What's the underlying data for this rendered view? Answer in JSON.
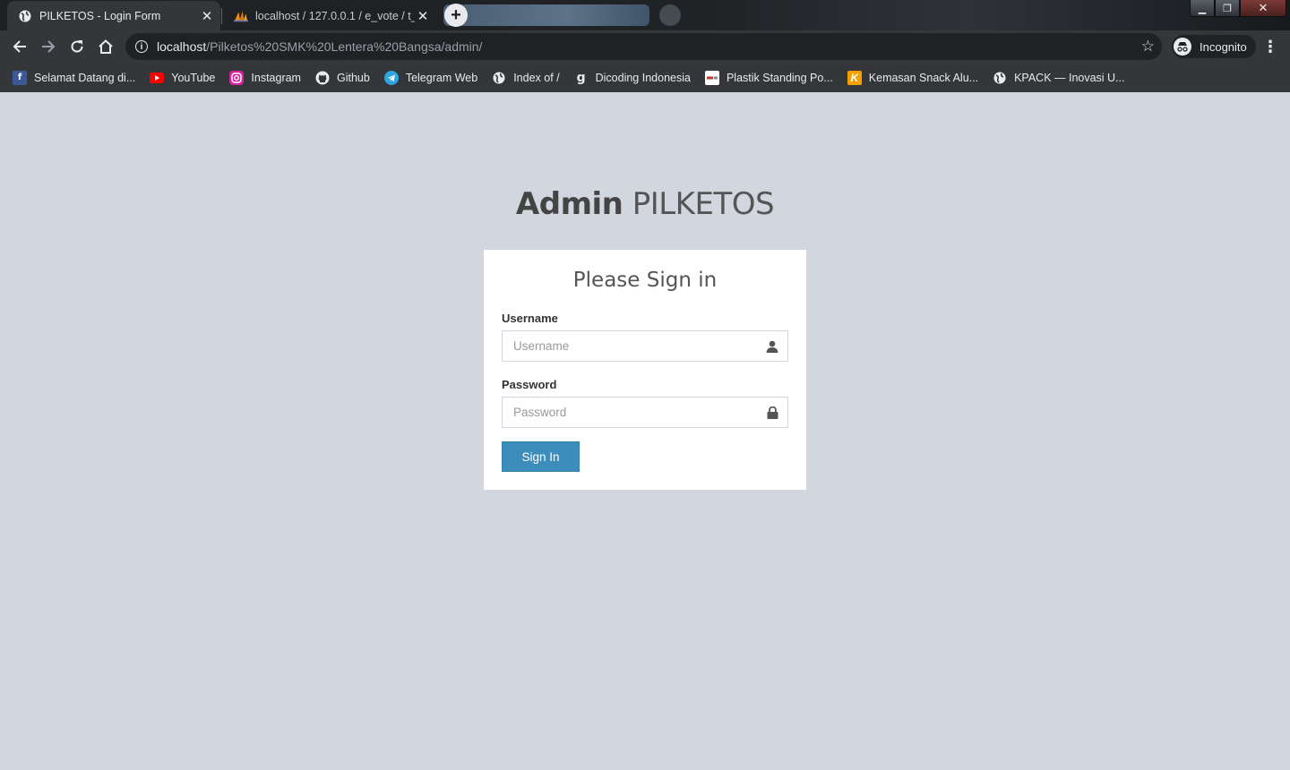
{
  "browser": {
    "tabs": [
      {
        "title": "PILKETOS - Login Form",
        "active": true
      },
      {
        "title": "localhost / 127.0.0.1 / e_vote / t_",
        "active": false
      }
    ],
    "new_tab_label": "+",
    "url_host": "localhost",
    "url_path": "/Pilketos%20SMK%20Lentera%20Bangsa/admin/",
    "incognito_label": "Incognito",
    "bookmarks": [
      {
        "label": "Selamat Datang di...",
        "icon": "facebook-icon"
      },
      {
        "label": "YouTube",
        "icon": "youtube-icon"
      },
      {
        "label": "Instagram",
        "icon": "instagram-icon"
      },
      {
        "label": "Github",
        "icon": "github-icon"
      },
      {
        "label": "Telegram Web",
        "icon": "telegram-icon"
      },
      {
        "label": "Index of /",
        "icon": "globe-icon"
      },
      {
        "label": "Dicoding Indonesia",
        "icon": "dicoding-icon"
      },
      {
        "label": "Plastik Standing Po...",
        "icon": "store-icon"
      },
      {
        "label": "Kemasan Snack Alu...",
        "icon": "k-icon"
      },
      {
        "label": "KPACK — Inovasi U...",
        "icon": "globe-icon"
      }
    ]
  },
  "page": {
    "logo_bold": "Admin",
    "logo_light": "PILKETOS",
    "box_title": "Please Sign in",
    "username_label": "Username",
    "username_placeholder": "Username",
    "username_value": "",
    "password_label": "Password",
    "password_placeholder": "Password",
    "password_value": "",
    "submit_label": "Sign In"
  },
  "colors": {
    "page_background": "#d2d6de",
    "button_primary": "#3c8dbc",
    "chrome_dark": "#35363a"
  }
}
